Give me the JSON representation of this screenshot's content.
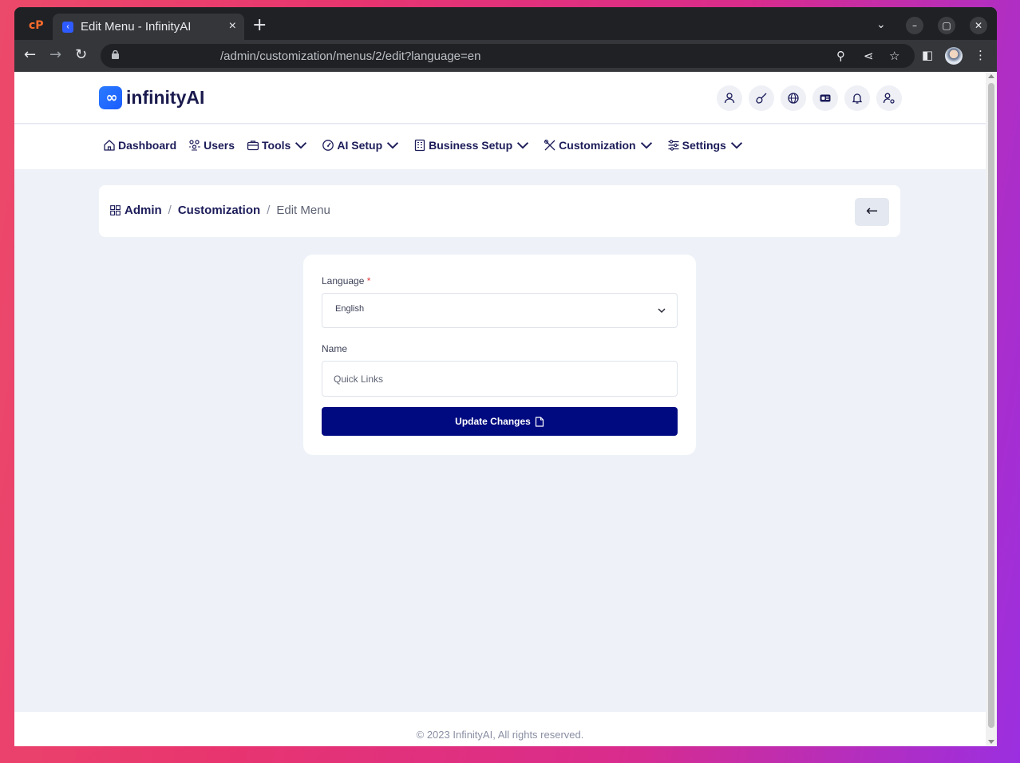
{
  "browser": {
    "tab_title": "Edit Menu - InfinityAI",
    "tab_close": "×",
    "new_tab": "+",
    "url": "/admin/customization/menus/2/edit?language=en",
    "window_controls": {
      "minimize": "–",
      "maximize": "▢",
      "close": "✕"
    }
  },
  "site": {
    "logo_mark": "∞",
    "logo_text": "infinityAI",
    "header_icons": [
      "user-icon",
      "broom-icon",
      "globe-icon",
      "id-card-icon",
      "bell-icon",
      "user-gear-icon"
    ]
  },
  "nav": {
    "items": [
      {
        "label": "Dashboard",
        "icon": "home-icon",
        "has_dropdown": false
      },
      {
        "label": "Users",
        "icon": "users-icon",
        "has_dropdown": false
      },
      {
        "label": "Tools",
        "icon": "briefcase-icon",
        "has_dropdown": true
      },
      {
        "label": "AI Setup",
        "icon": "gauge-icon",
        "has_dropdown": true
      },
      {
        "label": "Business Setup",
        "icon": "building-icon",
        "has_dropdown": true
      },
      {
        "label": "Customization",
        "icon": "tools-icon",
        "has_dropdown": true
      },
      {
        "label": "Settings",
        "icon": "sliders-icon",
        "has_dropdown": true
      }
    ]
  },
  "breadcrumb": {
    "admin": "Admin",
    "section": "Customization",
    "current": "Edit Menu",
    "separator": "/",
    "back_arrow": "←"
  },
  "form": {
    "language_label": "Language",
    "required_mark": "*",
    "language_value": "English",
    "name_label": "Name",
    "name_value": "Quick Links",
    "submit_label": "Update Changes"
  },
  "footer": {
    "text": "© 2023 InfinityAI, All rights reserved."
  },
  "colors": {
    "primary": "#000a80",
    "nav_text": "#1c1c5a",
    "page_bg": "#eef2f8"
  }
}
